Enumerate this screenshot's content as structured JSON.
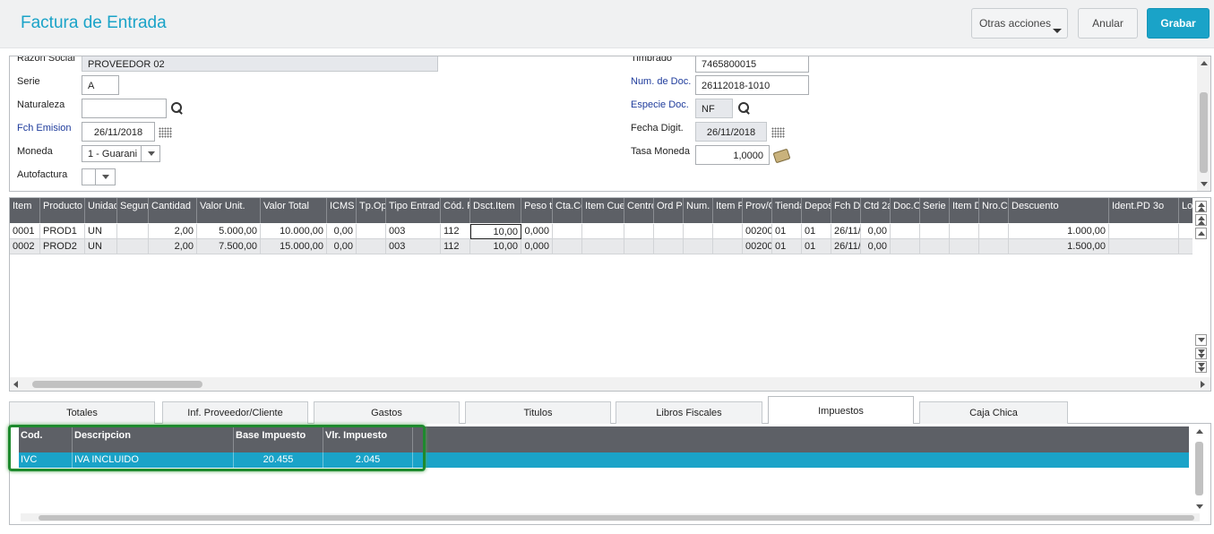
{
  "header": {
    "title": "Factura de Entrada",
    "otras_acciones": "Otras acciones",
    "anular": "Anular",
    "grabar": "Grabar"
  },
  "form": {
    "razon_social": {
      "label": "Razon Social",
      "value": "PROVEEDOR 02"
    },
    "serie": {
      "label": "Serie",
      "value": "A"
    },
    "naturaleza": {
      "label": "Naturaleza",
      "value": ""
    },
    "fch_emision": {
      "label": "Fch Emision",
      "value": "26/11/2018"
    },
    "moneda": {
      "label": "Moneda",
      "value": "1 - Guarani"
    },
    "autofactura": {
      "label": "Autofactura",
      "value": ""
    },
    "timbrado": {
      "label": "Timbrado",
      "value": "7465800015"
    },
    "num_doc": {
      "label": "Num. de Doc.",
      "value": "26112018-1010"
    },
    "especie_doc": {
      "label": "Especie Doc.",
      "value": "NF"
    },
    "fecha_digit": {
      "label": "Fecha Digit.",
      "value": "26/11/2018"
    },
    "tasa_moneda": {
      "label": "Tasa Moneda",
      "value": "1,0000"
    }
  },
  "items_grid": {
    "columns": [
      "Item",
      "Producto",
      "Unidad",
      "Segun",
      "Cantidad",
      "Valor Unit.",
      "Valor Total",
      "ICMS S",
      "Tp.Ope",
      "Tipo Entrada",
      "Cód. F",
      "Dsct.Item",
      "Peso to",
      "Cta.Co",
      "Item Cuen",
      "Centro",
      "Ord Pr",
      "Num. F",
      "Item Pe",
      "Prov/C",
      "Tienda",
      "Depos",
      "Fch Di",
      "Ctd 2a",
      "Doc.O",
      "Serie (",
      "Item De",
      "Nro.Ct",
      "Descuento",
      "Ident.PD 3o",
      "Lot"
    ],
    "rows": [
      [
        "0001",
        "PROD1",
        "UN",
        "",
        "2,00",
        "5.000,00",
        "10.000,00",
        "0,00",
        "",
        "003",
        "112",
        "10,00",
        "0,000",
        "",
        "",
        "",
        "",
        "",
        "",
        "00200",
        "01",
        "01",
        "26/11/",
        "0,00",
        "",
        "",
        "",
        "",
        "1.000,00",
        "",
        ""
      ],
      [
        "0002",
        "PROD2",
        "UN",
        "",
        "2,00",
        "7.500,00",
        "15.000,00",
        "0,00",
        "",
        "003",
        "112",
        "10,00",
        "0,000",
        "",
        "",
        "",
        "",
        "",
        "",
        "00200",
        "01",
        "01",
        "26/11/",
        "0,00",
        "",
        "",
        "",
        "",
        "1.500,00",
        "",
        ""
      ]
    ]
  },
  "tabs": [
    "Totales",
    "Inf. Proveedor/Cliente",
    "Gastos",
    "Titulos",
    "Libros Fiscales",
    "Impuestos",
    "Caja Chica"
  ],
  "active_tab": "Impuestos",
  "tax_grid": {
    "columns": [
      "Cod.",
      "Descripcion",
      "Base Impuesto",
      "Vlr. Impuesto"
    ],
    "rows": [
      [
        "IVC",
        "IVA INCLUIDO",
        "20.455",
        "2.045"
      ]
    ]
  },
  "colors": {
    "accent": "#1aa3c8",
    "grid_header": "#5d6066",
    "highlight_box": "#1e8a2e",
    "blue_label": "#1f3c9c"
  }
}
